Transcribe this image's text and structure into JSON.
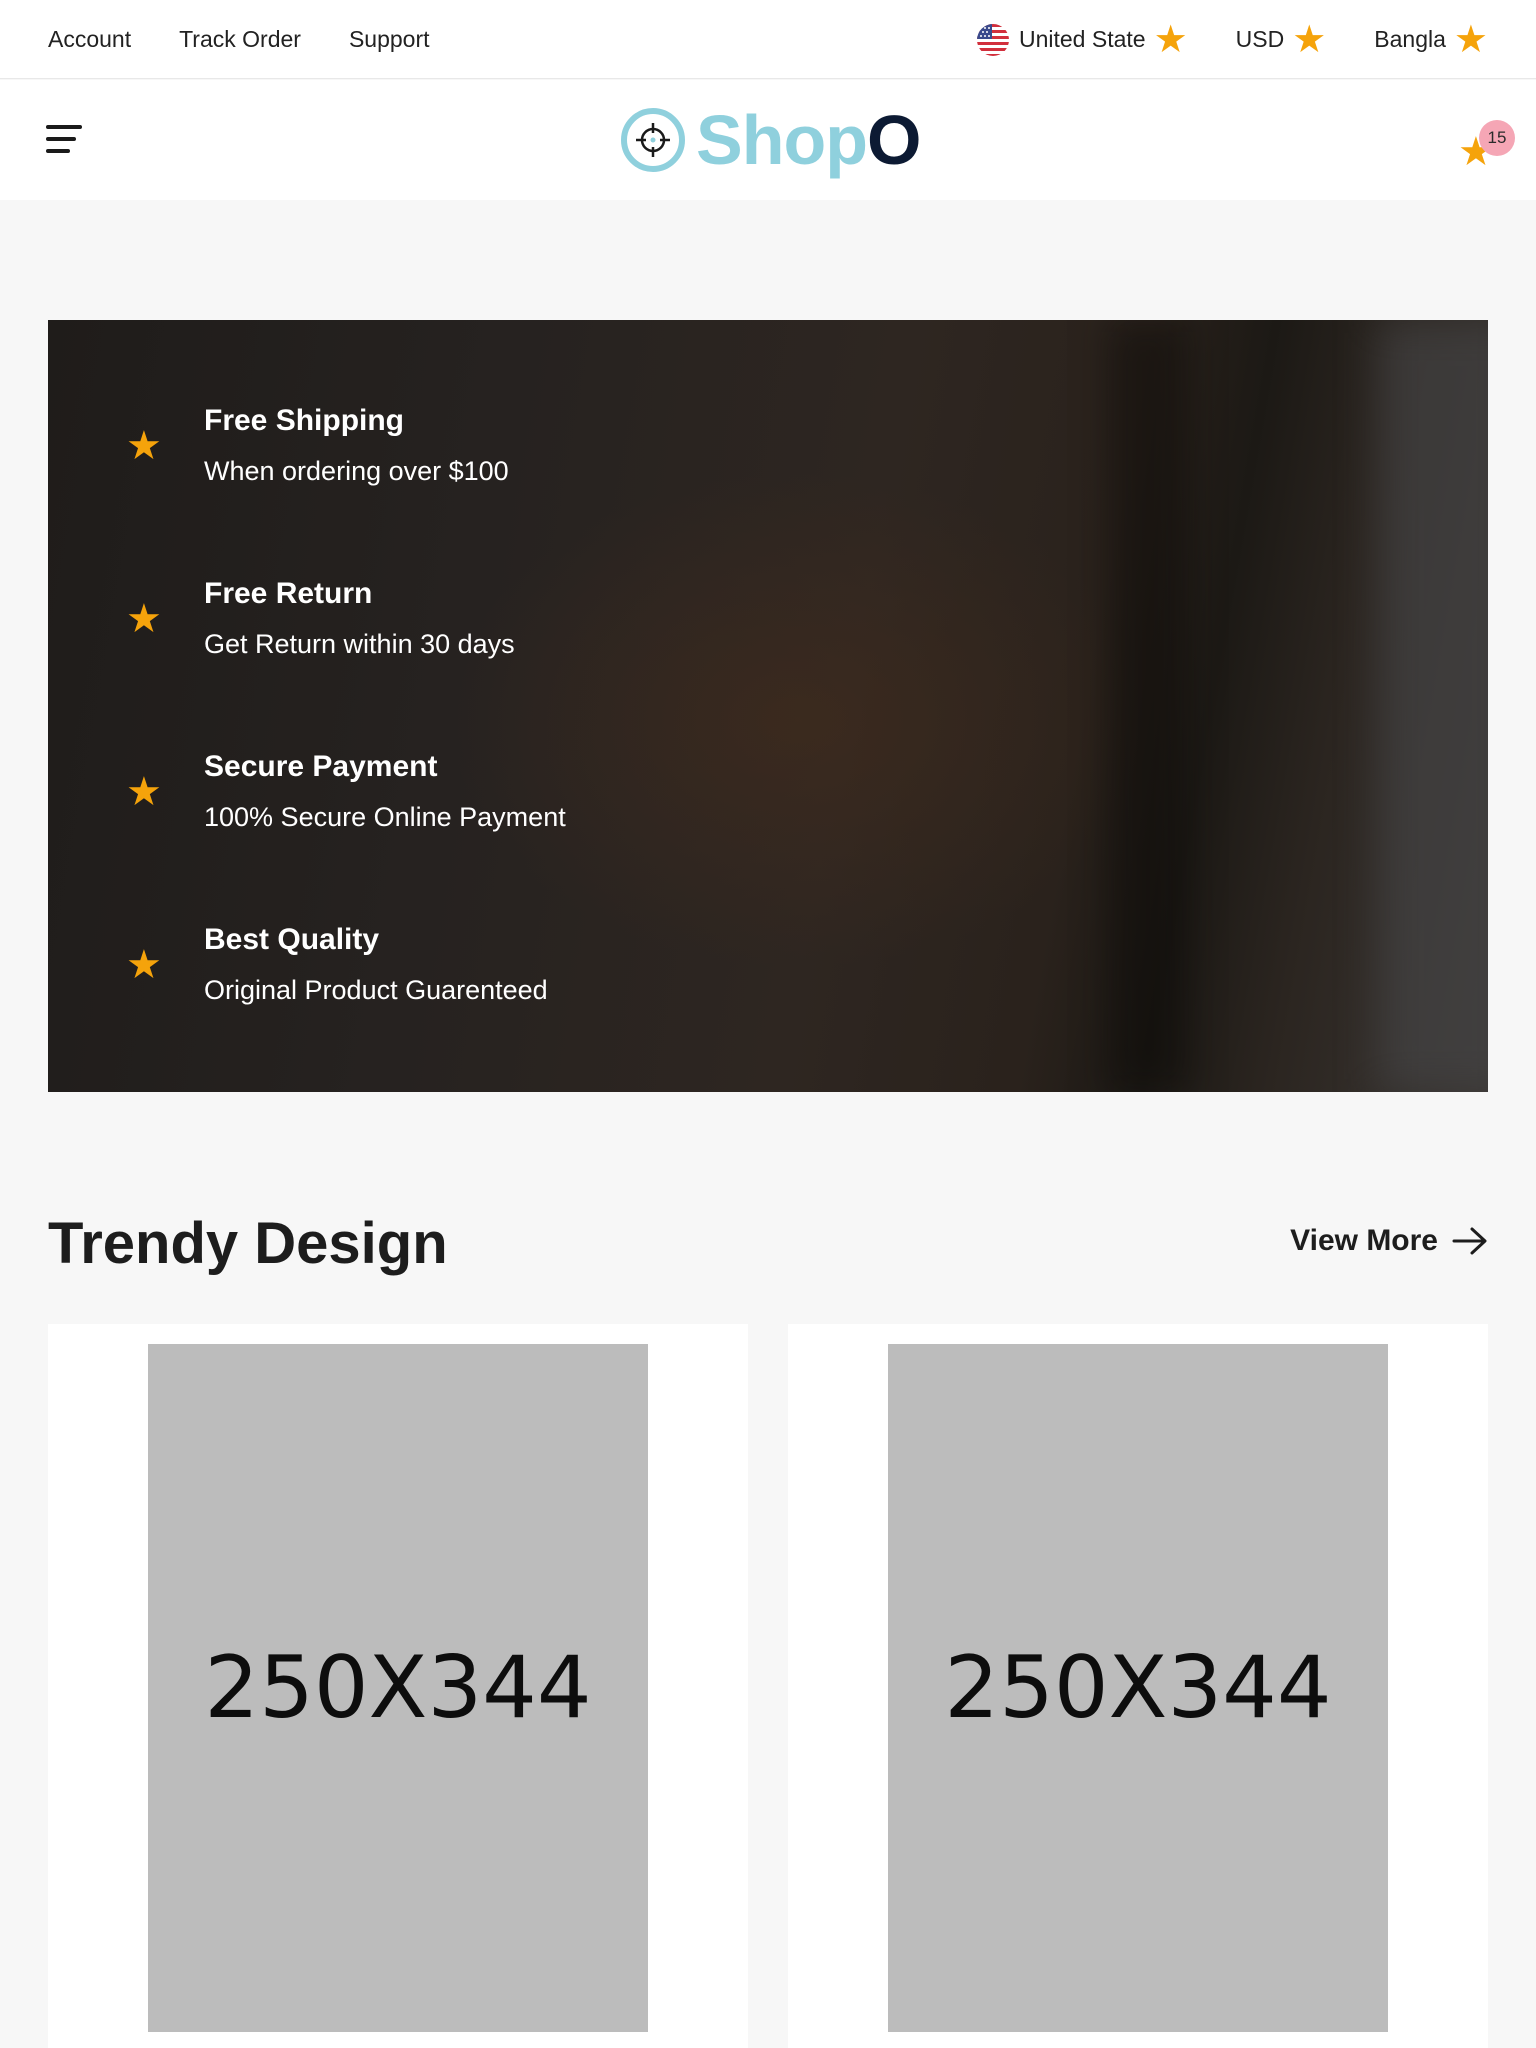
{
  "topbar": {
    "links": [
      "Account",
      "Track Order",
      "Support"
    ],
    "country": "United State",
    "currency": "USD",
    "language": "Bangla"
  },
  "header": {
    "logo_main": "Shop",
    "logo_tail": "O",
    "cart_count": "15"
  },
  "banner": {
    "features": [
      {
        "title": "Free Shipping",
        "desc": "When ordering over $100"
      },
      {
        "title": "Free Return",
        "desc": "Get Return within 30 days"
      },
      {
        "title": "Secure Payment",
        "desc": "100% Secure Online Payment"
      },
      {
        "title": "Best Quality",
        "desc": "Original Product Guarenteed"
      }
    ]
  },
  "section": {
    "title": "Trendy Design",
    "view_more": "View More"
  },
  "products": [
    {
      "image_label": "250X344"
    },
    {
      "image_label": "250X344"
    }
  ],
  "colors": {
    "accent_star": "#f5a30b",
    "logo_light": "#8fd0dd",
    "logo_dark": "#0c1a33",
    "badge": "#f5a6b5"
  },
  "icons": {
    "menu": "hamburger-menu-icon",
    "cart": "star-icon",
    "arrow": "arrow-right-icon"
  }
}
